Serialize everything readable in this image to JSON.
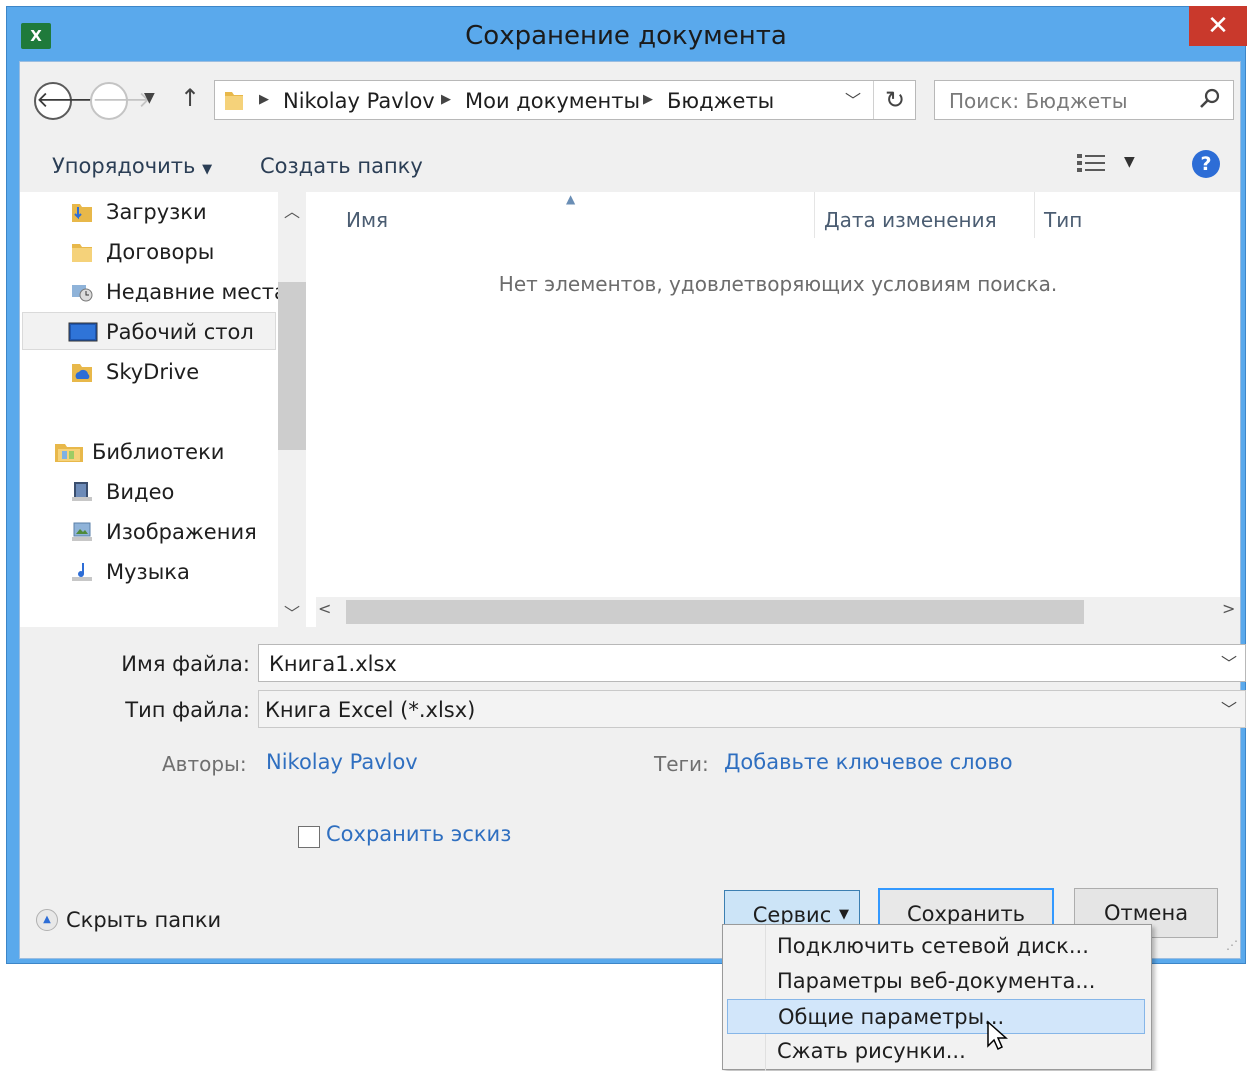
{
  "window": {
    "title": "Сохранение документа",
    "app_icon": "excel-icon",
    "close_glyph": "✕"
  },
  "address": {
    "crumbs": [
      "Nikolay Pavlov",
      "Мои документы",
      "Бюджеты"
    ],
    "search_placeholder": "Поиск: Бюджеты"
  },
  "toolbar": {
    "organize": "Упорядочить",
    "new_folder": "Создать папку"
  },
  "nav": {
    "items": [
      "Загрузки",
      "Договоры",
      "Недавние места",
      "Рабочий стол",
      "SkyDrive"
    ],
    "libraries": "Библиотеки",
    "library_items": [
      "Видео",
      "Изображения",
      "Музыка"
    ],
    "selected": "Рабочий стол"
  },
  "list": {
    "columns": [
      "Имя",
      "Дата изменения",
      "Тип"
    ],
    "empty_message": "Нет элементов, удовлетворяющих условиям поиска."
  },
  "form": {
    "filename_label": "Имя файла:",
    "filename_value": "Книга1.xlsx",
    "filetype_label": "Тип файла:",
    "filetype_value": "Книга Excel (*.xlsx)",
    "authors_label": "Авторы:",
    "authors_value": "Nikolay Pavlov",
    "tags_label": "Теги:",
    "tags_value": "Добавьте ключевое слово",
    "thumbnail_label": "Сохранить эскиз",
    "thumbnail_checked": false
  },
  "buttons": {
    "hide_folders": "Скрыть папки",
    "service": "Сервис",
    "save": "Сохранить",
    "cancel": "Отмена"
  },
  "service_menu": {
    "items": [
      "Подключить сетевой диск...",
      "Параметры веб-документа...",
      "Общие параметры...",
      "Сжать рисунки..."
    ],
    "highlighted": "Общие параметры..."
  },
  "colors": {
    "titlebar": "#5aa9ec",
    "close": "#c9392c",
    "link": "#2f6fc0",
    "menu_highlight": "#d2e6fa"
  }
}
